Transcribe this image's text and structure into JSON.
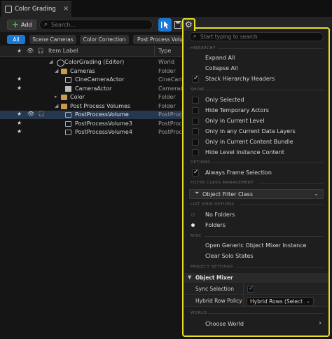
{
  "tab": {
    "title": "Color Grading",
    "close": "×"
  },
  "toolbar": {
    "add_label": "Add",
    "search_placeholder": "Search..."
  },
  "filters": [
    "All",
    "Scene Cameras",
    "Color Correction",
    "Post Process Volume"
  ],
  "columns": {
    "item_label": "Item Label",
    "type": "Type"
  },
  "rows": [
    {
      "name": "ColorGrading (Editor)",
      "type": "World"
    },
    {
      "name": "Cameras",
      "type": "Folder"
    },
    {
      "name": "CineCameraActor",
      "type": "CineCam"
    },
    {
      "name": "CameraActor",
      "type": "CameraA"
    },
    {
      "name": "Color",
      "type": "Folder"
    },
    {
      "name": "Post Process Volumes",
      "type": "Folder"
    },
    {
      "name": "PostProcessVolume",
      "type": "PostProc"
    },
    {
      "name": "PostProcessVolume3",
      "type": "PostProc"
    },
    {
      "name": "PostProcessVolume4",
      "type": "PostProc"
    }
  ],
  "menu": {
    "search_placeholder": "Start typing to search",
    "sections": {
      "hierarchy": "HIERARCHY",
      "show": "SHOW",
      "options": "OPTIONS",
      "filter_class": "FILTER CLASS MANAGEMENT",
      "list_view": "LIST VIEW OPTIONS",
      "misc": "MISC",
      "project_settings": "PROJECT SETTINGS",
      "world": "WORLD"
    },
    "hierarchy_items": [
      "Expand All",
      "Collapse All",
      "Stack Hierarchy Headers"
    ],
    "show_items": [
      "Only Selected",
      "Hide Temporary Actors",
      "Only in Current Level",
      "Only in any Current Data Layers",
      "Only in Current Content Bundle",
      "Hide Level Instance Content"
    ],
    "options_items": [
      "Always Frame Selection"
    ],
    "object_filter_class": "Object Filter Class",
    "list_view_items": [
      "No Folders",
      "Folders"
    ],
    "misc_items": [
      "Open Generic Object Mixer Instance",
      "Clear Solo States"
    ],
    "object_mixer": {
      "header": "Object Mixer",
      "sync_selection_label": "Sync Selection",
      "hybrid_row_policy_label": "Hybrid Row Policy",
      "hybrid_row_policy_value": "Hybrid Rows (Select Ac"
    },
    "choose_world": "Choose World"
  }
}
